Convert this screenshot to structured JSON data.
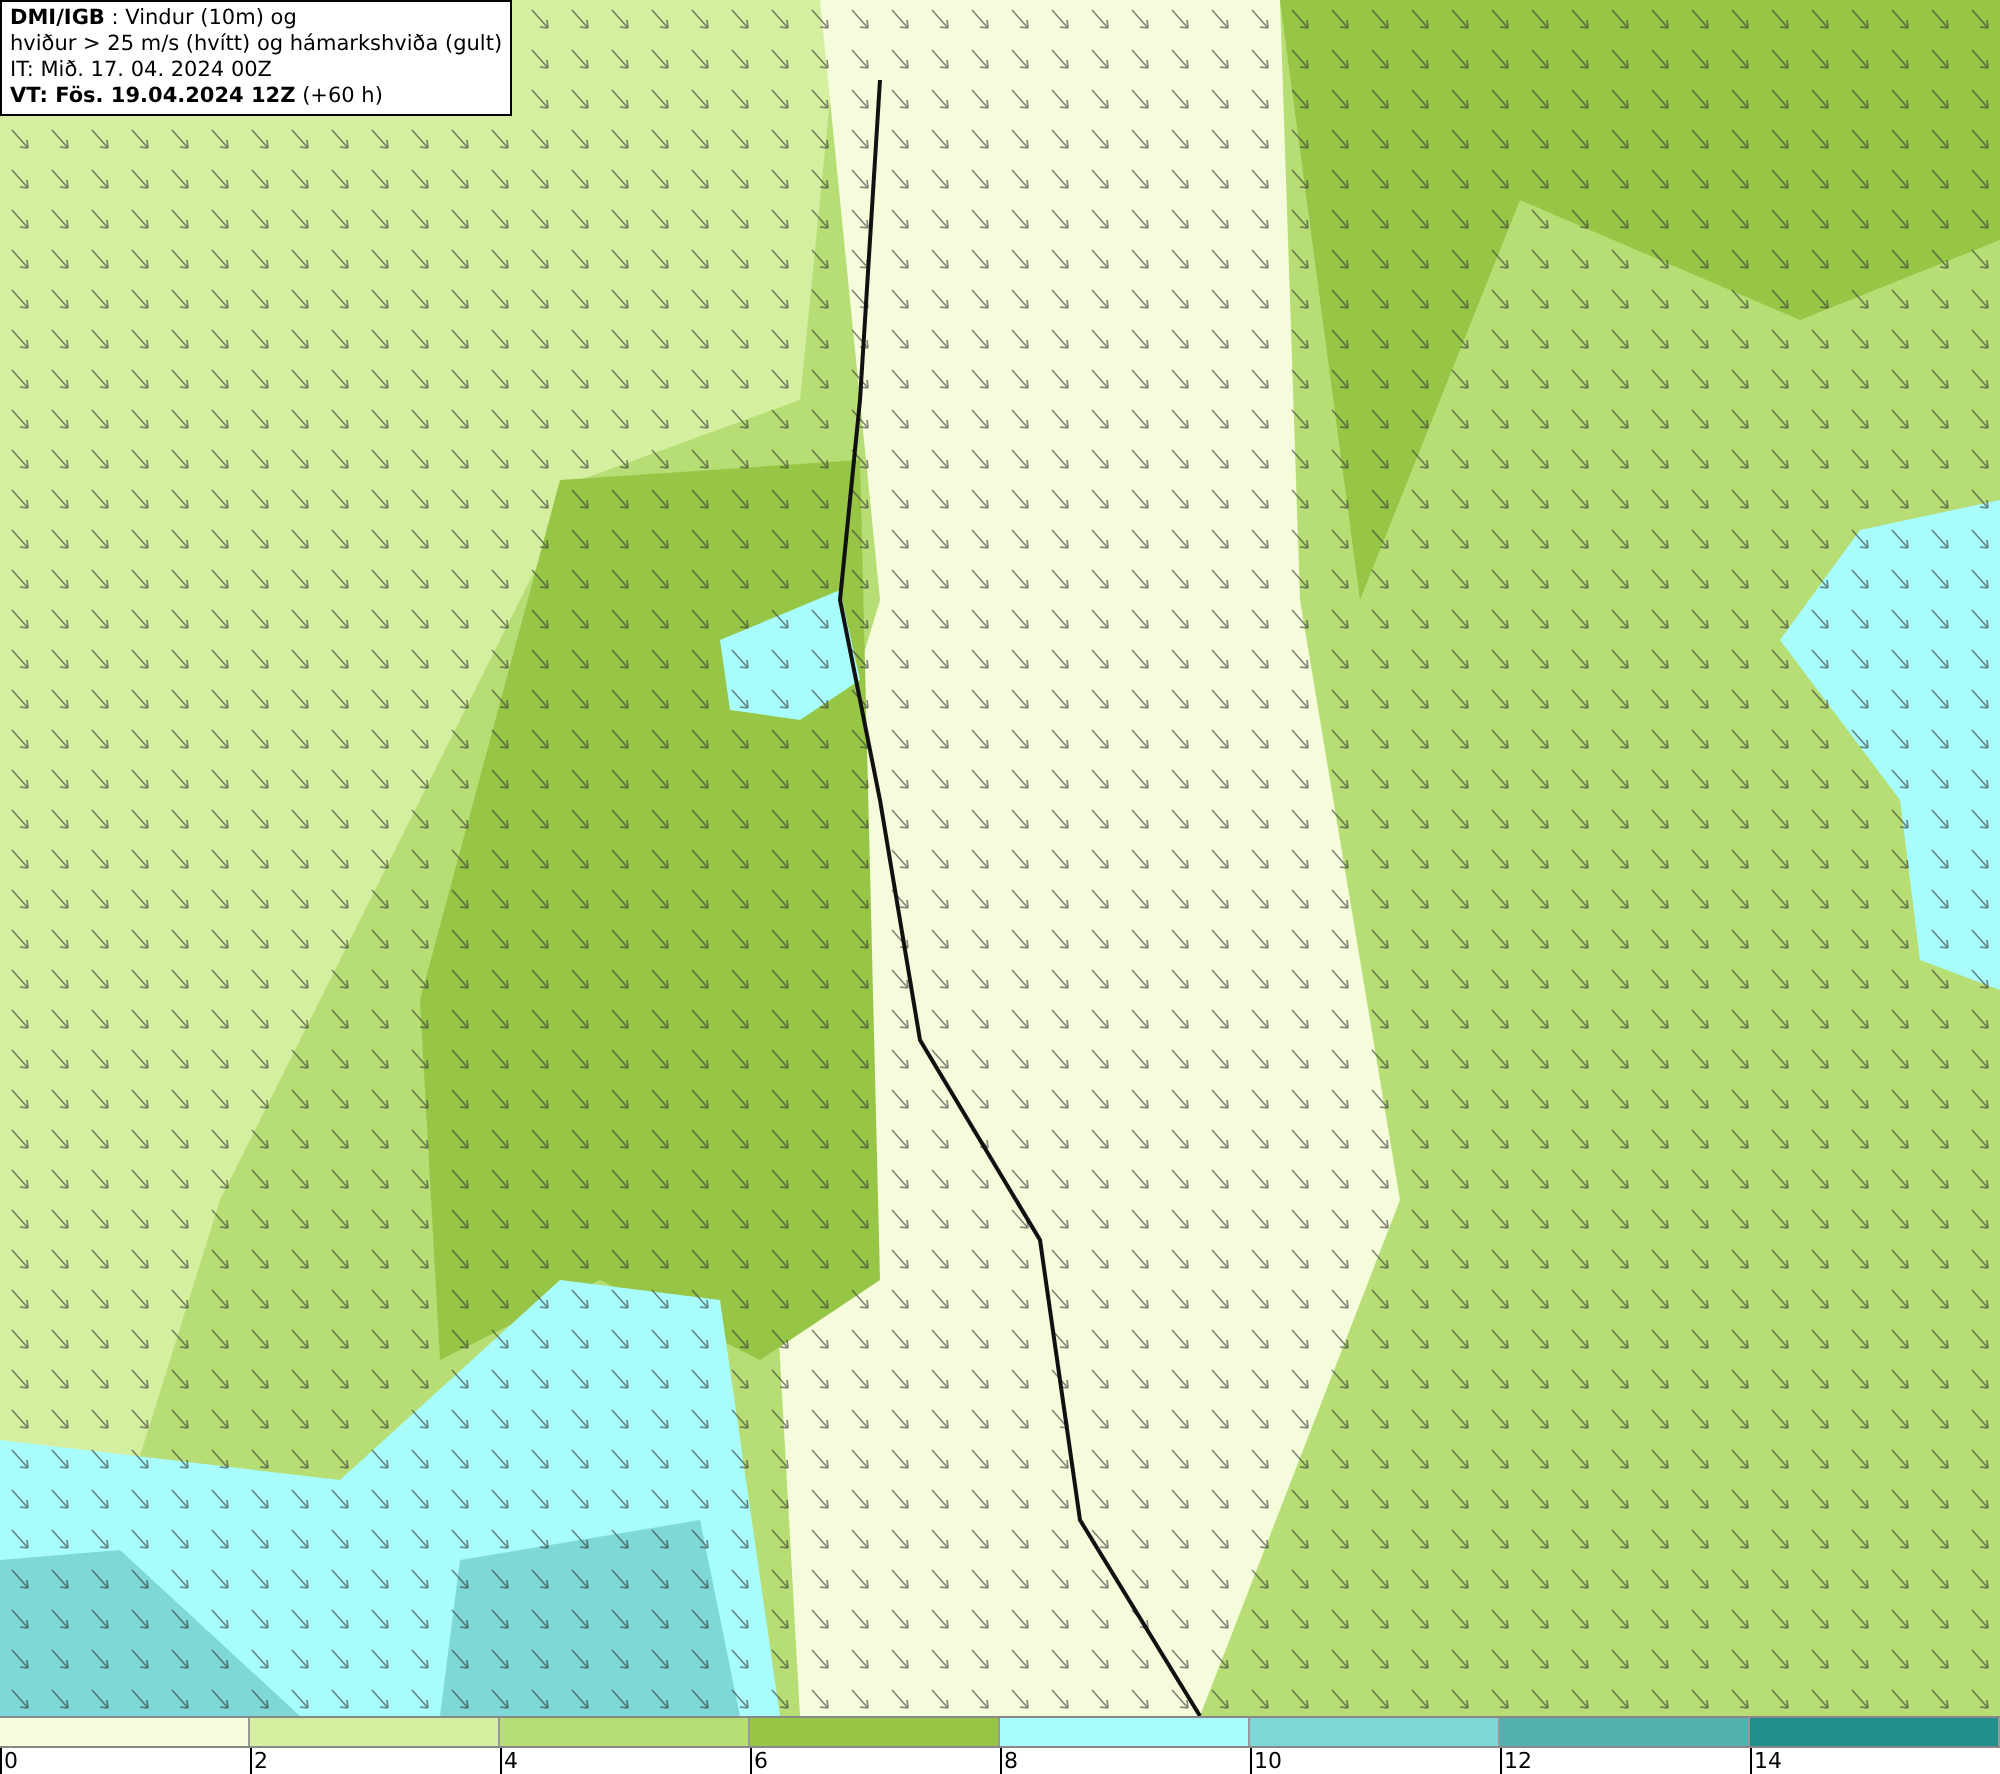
{
  "title_box": {
    "lines": [
      "**DMI/IGB** : Vindur (10m) og",
      "hviður > 25 m/s (hvítt) og hámarkshviða (gult)",
      "IT: Mið. 17. 04. 2024 00Z",
      "**VT: Fös. 19.04.2024 12Z** (+60 h)"
    ]
  },
  "legend": {
    "segments": [
      {
        "color": "#f5fcdc"
      },
      {
        "color": "#d5efa0"
      },
      {
        "color": "#b6de74"
      },
      {
        "color": "#97c545"
      },
      {
        "color": "#a8fcfc"
      },
      {
        "color": "#7fd8d8"
      },
      {
        "color": "#52b2b0"
      },
      {
        "color": "#238f8c"
      }
    ],
    "ticks": [
      "0",
      "2",
      "4",
      "6",
      "8",
      "10",
      "12",
      "14"
    ]
  }
}
